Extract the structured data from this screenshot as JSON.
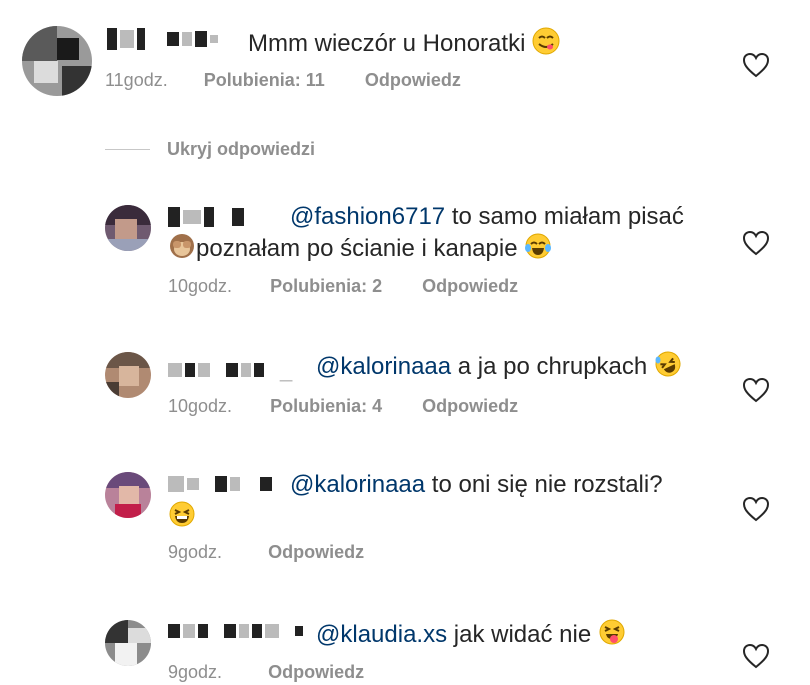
{
  "comment": {
    "text": "Mmm wieczór u Honoratki",
    "time": "11godz.",
    "likes": "Polubienia: 11",
    "reply": "Odpowiedz"
  },
  "toggle_replies": "Ukryj odpowiedzi",
  "replies": [
    {
      "mention": "@fashion6717",
      "text": "to samo miałam pisać",
      "text2": "poznałam po ścianie i kanapie",
      "time": "10godz.",
      "likes": "Polubienia: 2",
      "reply": "Odpowiedz"
    },
    {
      "name_suffix": "_",
      "mention": "@kalorinaaa",
      "text": "a ja po chrupkach",
      "time": "10godz.",
      "likes": "Polubienia: 4",
      "reply": "Odpowiedz"
    },
    {
      "mention": "@kalorinaaa",
      "text": "to oni się nie rozstali?",
      "time": "9godz.",
      "reply": "Odpowiedz"
    },
    {
      "mention": "@klaudia.xs",
      "text": "jak widać nie",
      "time": "9godz.",
      "reply": "Odpowiedz"
    }
  ],
  "icons": [
    "heart-icon",
    "face-savoring-food-emoji",
    "see-no-evil-monkey-emoji",
    "tears-of-joy-emoji",
    "rolling-on-floor-laughing-emoji",
    "grinning-squinting-emoji",
    "squinting-tongue-emoji"
  ]
}
